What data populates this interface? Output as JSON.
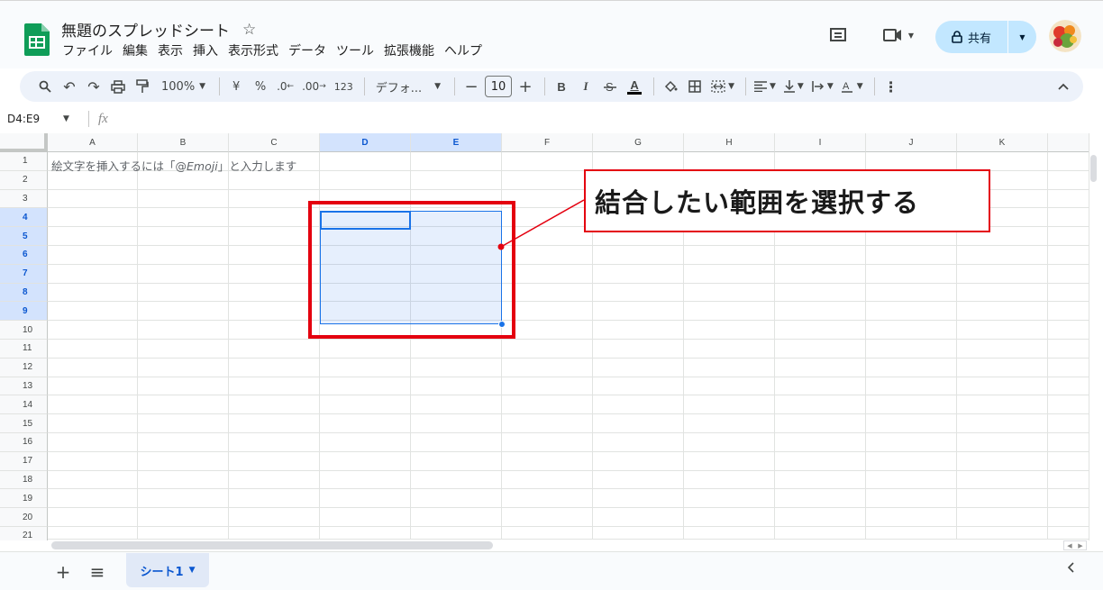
{
  "header": {
    "doc_title": "無題のスプレッドシート",
    "star_glyph": "☆",
    "menu": [
      "ファイル",
      "編集",
      "表示",
      "挿入",
      "表示形式",
      "データ",
      "ツール",
      "拡張機能",
      "ヘルプ"
    ],
    "share_label": "共有",
    "icons": [
      "comment-icon",
      "video-call-icon",
      "lock-icon",
      "avatar"
    ]
  },
  "toolbar": {
    "zoom": "100%",
    "currency": "¥",
    "percent": "%",
    "decimal_decrease": ".0",
    "decimal_increase": ".00",
    "format_number": "123",
    "font_name": "デフォ...",
    "font_size": "10",
    "bold": "B",
    "italic": "I",
    "text_color": "A"
  },
  "formula_bar": {
    "name_box": "D4:E9",
    "fx": "fx"
  },
  "grid": {
    "columns": [
      "A",
      "B",
      "C",
      "D",
      "E",
      "F",
      "G",
      "H",
      "I",
      "J",
      "K"
    ],
    "rows": [
      "1",
      "2",
      "3",
      "4",
      "5",
      "6",
      "7",
      "8",
      "9",
      "10",
      "11",
      "12",
      "13",
      "14",
      "15",
      "16",
      "17",
      "18",
      "19",
      "20",
      "21"
    ],
    "selected_columns": [
      "D",
      "E"
    ],
    "selected_rows": [
      "4",
      "5",
      "6",
      "7",
      "8",
      "9"
    ],
    "a1_text_before": "絵文字を挿入するには「@",
    "a1_text_emph": "Emoji",
    "a1_text_after": "」と入力します"
  },
  "annotation": {
    "callout_text": "結合したい範囲を選択する",
    "color": "#e4000f"
  },
  "sheets": {
    "tabs": [
      "シート1"
    ],
    "add_glyph": "+",
    "menu_glyph": "≡"
  },
  "colors": {
    "selection_blue": "#1a73e8",
    "header_selected": "#d3e3fd",
    "share_bg": "#c2e7ff",
    "logo_green": "#0f9d58"
  }
}
